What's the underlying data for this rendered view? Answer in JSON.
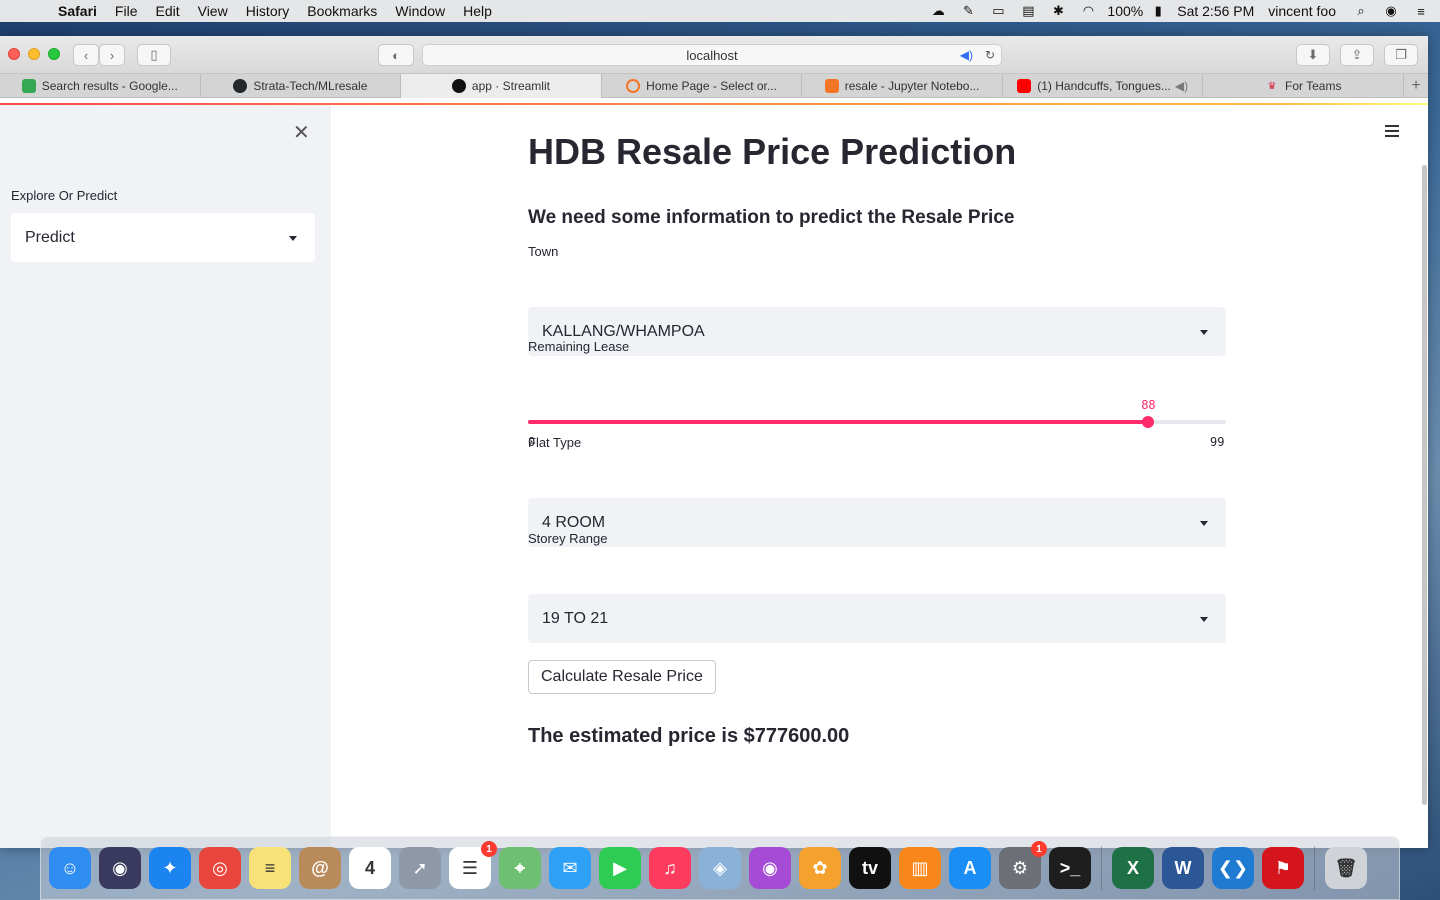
{
  "menubar": {
    "app_name": "Safari",
    "items": [
      "File",
      "Edit",
      "View",
      "History",
      "Bookmarks",
      "Window",
      "Help"
    ],
    "battery": "100%",
    "clock": "Sat 2:56 PM",
    "user": "vincent foo"
  },
  "browser": {
    "address": "localhost",
    "tabs": [
      {
        "label": "Search results - Google...",
        "fav_color": "#34a853"
      },
      {
        "label": "Strata-Tech/MLresale",
        "fav_color": "#24292e"
      },
      {
        "label": "app · Streamlit",
        "fav_color": "#111111"
      },
      {
        "label": "Home Page - Select or...",
        "fav_color": "#f37626"
      },
      {
        "label": "resale - Jupyter Notebo...",
        "fav_color": "#f37626"
      },
      {
        "label": "(1) Handcuffs, Tongues...",
        "fav_color": "#ff0000"
      },
      {
        "label": "For Teams",
        "fav_color": "#d7263d"
      }
    ]
  },
  "sidebar": {
    "label": "Explore Or Predict",
    "selected": "Predict"
  },
  "main": {
    "title": "HDB Resale Price Prediction",
    "subtitle": "We need some information to predict the Resale Price",
    "town": {
      "label": "Town",
      "value": "KALLANG/WHAMPOA"
    },
    "lease": {
      "label": "Remaining Lease",
      "value": "88",
      "min": "0",
      "max": "99",
      "fraction": 0.8889
    },
    "flat_type": {
      "label": "Flat Type",
      "value": "4 ROOM"
    },
    "storey": {
      "label": "Storey Range",
      "value": "19 TO 21"
    },
    "button_label": "Calculate Resale Price",
    "result": "The estimated price is $777600.00"
  },
  "colors": {
    "accent": "#ff2b6a",
    "sidebar_bg": "#f0f2f6"
  },
  "dock": {
    "apps": [
      {
        "name": "finder-icon",
        "color": "#2f8cf0",
        "glyph": "☺"
      },
      {
        "name": "siri-icon",
        "color": "#3a3a5e",
        "glyph": "◉"
      },
      {
        "name": "safari-icon",
        "color": "#1b84f0",
        "glyph": "✦"
      },
      {
        "name": "chrome-icon",
        "color": "#e8453c",
        "glyph": "◎"
      },
      {
        "name": "notes-icon",
        "color": "#f7e27a",
        "glyph": "≡"
      },
      {
        "name": "contacts-icon",
        "color": "#b98a5a",
        "glyph": "@"
      },
      {
        "name": "calendar-icon",
        "color": "#ffffff",
        "glyph": "4"
      },
      {
        "name": "launchpad-icon",
        "color": "#8f98a6",
        "glyph": "➚"
      },
      {
        "name": "reminders-icon",
        "color": "#ffffff",
        "glyph": "☰",
        "badge": "1"
      },
      {
        "name": "maps-icon",
        "color": "#6fbf73",
        "glyph": "⌖"
      },
      {
        "name": "messages-icon",
        "color": "#2ea1f7",
        "glyph": "✉"
      },
      {
        "name": "facetime-icon",
        "color": "#2ecc52",
        "glyph": "▶"
      },
      {
        "name": "music-icon",
        "color": "#fc3c5f",
        "glyph": "♫"
      },
      {
        "name": "preview-icon",
        "color": "#8ab2d8",
        "glyph": "◈"
      },
      {
        "name": "podcasts-icon",
        "color": "#a54bd6",
        "glyph": "◉"
      },
      {
        "name": "photos-icon",
        "color": "#f4a22d",
        "glyph": "✿"
      },
      {
        "name": "appletv-icon",
        "color": "#111111",
        "glyph": "tv"
      },
      {
        "name": "books-icon",
        "color": "#f7861b",
        "glyph": "▥"
      },
      {
        "name": "appstore-icon",
        "color": "#1a8ef5",
        "glyph": "A"
      },
      {
        "name": "system-preferences-icon",
        "color": "#6c6f75",
        "glyph": "⚙",
        "badge": "1"
      },
      {
        "name": "terminal-icon",
        "color": "#1e1e1e",
        "glyph": ">_"
      }
    ],
    "apps2": [
      {
        "name": "excel-icon",
        "color": "#1d7145",
        "glyph": "X"
      },
      {
        "name": "word-icon",
        "color": "#2b5797",
        "glyph": "W"
      },
      {
        "name": "vscode-icon",
        "color": "#1f7ad1",
        "glyph": "❮❯"
      },
      {
        "name": "acrobat-icon",
        "color": "#d4161c",
        "glyph": "⚑"
      }
    ],
    "trash": {
      "name": "trash-icon",
      "color": "#cfd3d8",
      "glyph": "🗑"
    }
  }
}
